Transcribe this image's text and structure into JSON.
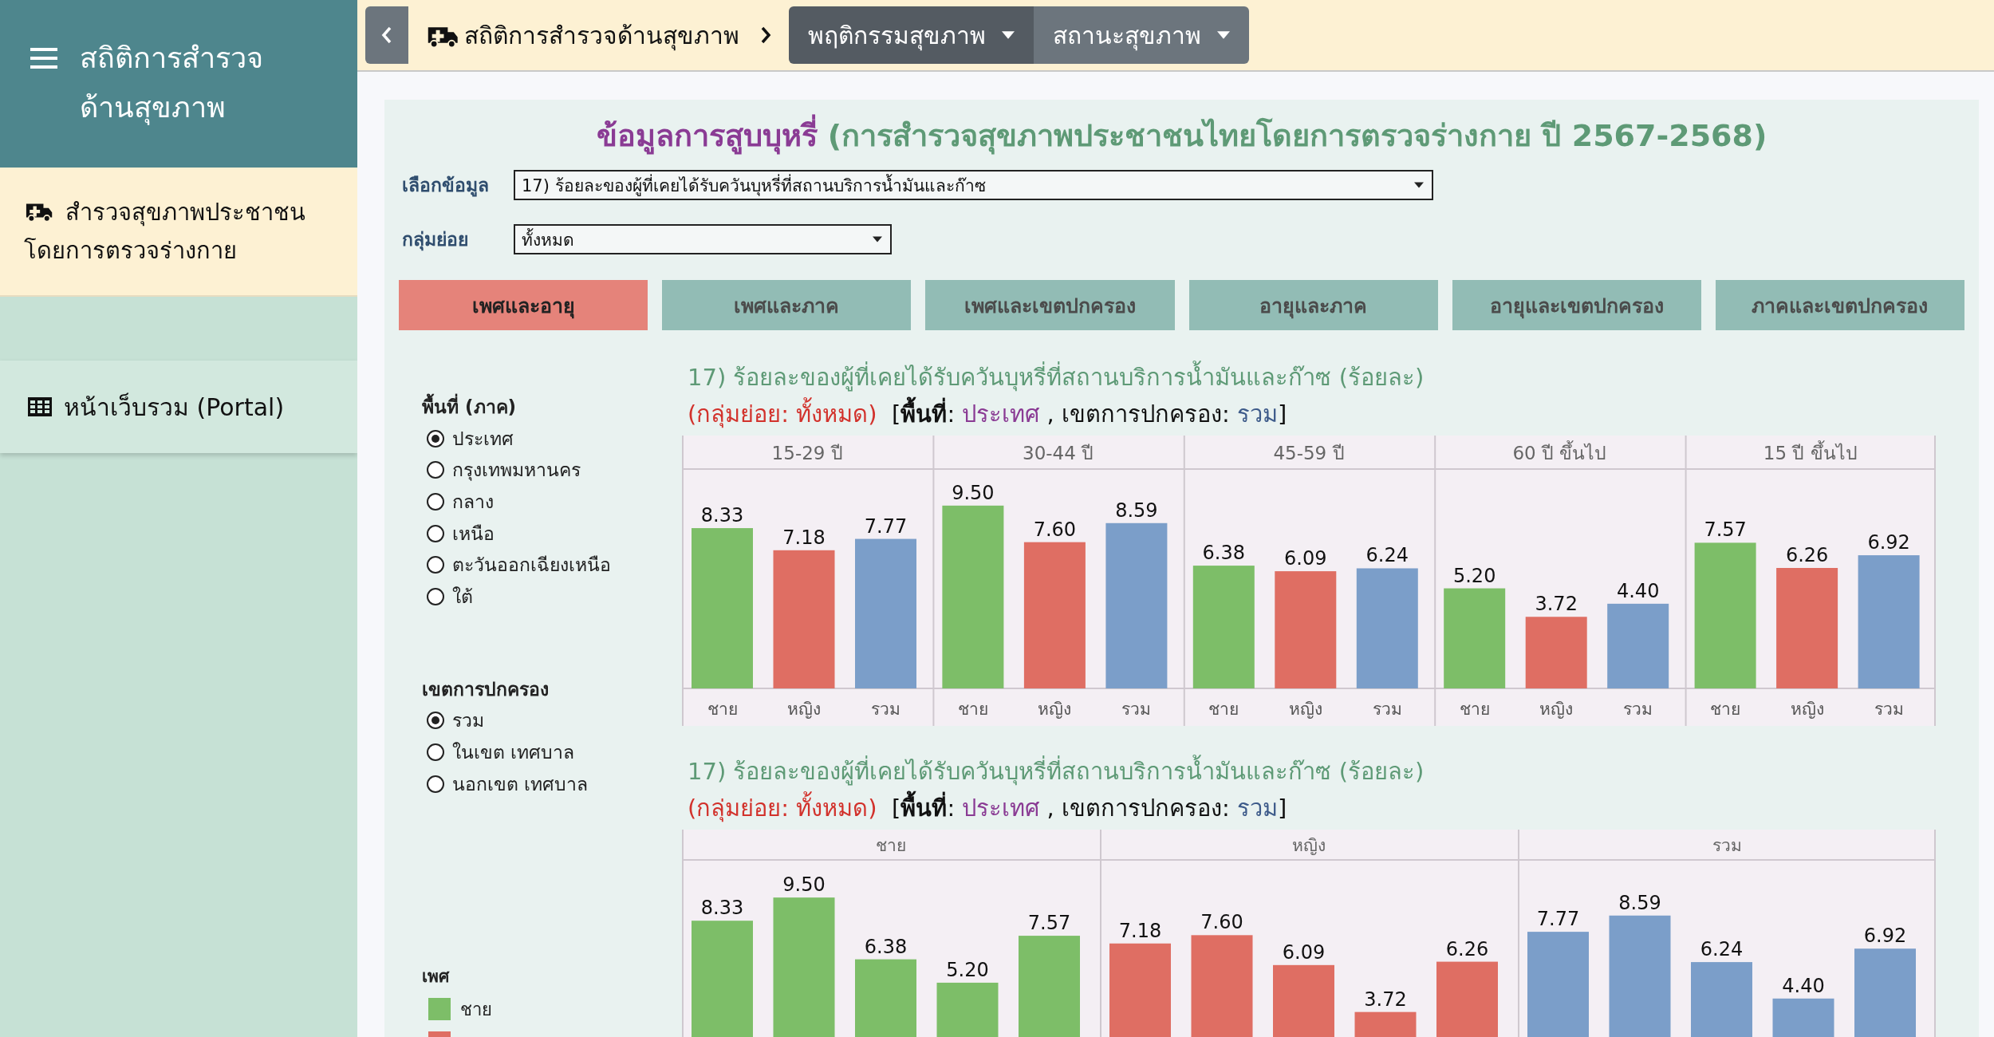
{
  "sidebar": {
    "title_lines": [
      "สถิติการสำรวจ",
      "ด้านสุขภาพ"
    ],
    "items": [
      {
        "label": "สำรวจสุขภาพประชาชน โดยการตรวจร่างกาย",
        "kind": "survey"
      },
      {
        "label": "หน้าเว็บรวม (Portal)",
        "kind": "portal"
      }
    ]
  },
  "topbar": {
    "breadcrumb": "สถิติการสำรวจด้านสุขภาพ",
    "menus": [
      {
        "label": "พฤติกรรมสุขภาพ",
        "selected": true
      },
      {
        "label": "สถานะสุขภาพ",
        "selected": false
      }
    ]
  },
  "page": {
    "title": [
      {
        "kind": "topic",
        "text": "ข้อมูลการสูบบุหรี่"
      },
      {
        "kind": "survey",
        "text": " (การสำรวจสุขภาพประชาชนไทยโดยการตรวจร่างกาย ปี 2567-2568)"
      }
    ],
    "fields": [
      {
        "label": "เลือกข้อมูล",
        "value": "17) ร้อยละของผู้ที่เคยได้รับควันบุหรี่ที่สถานบริการน้ำมันและก๊าซ",
        "kind": "wide"
      },
      {
        "label": "กลุ่มย่อย",
        "value": "ทั้งหมด",
        "kind": "narrow"
      }
    ]
  },
  "tabs": [
    {
      "label": "เพศและอายุ",
      "selected": true
    },
    {
      "label": "เพศและภาค",
      "selected": false
    },
    {
      "label": "เพศและเขตปกครอง",
      "selected": false
    },
    {
      "label": "อายุและภาค",
      "selected": false
    },
    {
      "label": "อายุและเขตปกครอง",
      "selected": false
    },
    {
      "label": "ภาคและเขตปกครอง",
      "selected": false
    }
  ],
  "filters": [
    {
      "title": "พื้นที่ (ภาค)",
      "options": [
        {
          "label": "ประเทศ",
          "selected": true
        },
        {
          "label": "กรุงเทพมหานคร",
          "selected": false
        },
        {
          "label": "กลาง",
          "selected": false
        },
        {
          "label": "เหนือ",
          "selected": false
        },
        {
          "label": "ตะวันออกเฉียงเหนือ",
          "selected": false
        },
        {
          "label": "ใต้",
          "selected": false
        }
      ]
    },
    {
      "title": "เขตการปกครอง",
      "options": [
        {
          "label": "รวม",
          "selected": true
        },
        {
          "label": "ในเขต เทศบาล",
          "selected": false
        },
        {
          "label": "นอกเขต เทศบาล",
          "selected": false
        }
      ]
    }
  ],
  "legend": {
    "title": "เพศ",
    "items": [
      {
        "label": "ชาย",
        "color": "#7dbe68"
      },
      {
        "color": "#df6e63"
      }
    ]
  },
  "charts": [
    {
      "title": "17) ร้อยละของผู้ที่เคยได้รับควันบุหรี่ที่สถานบริการน้ำมันและก๊าซ (ร้อยละ)",
      "subtitle": [
        {
          "kind": "group",
          "text": "(กลุ่มย่อย: ทั้งหมด)"
        },
        {
          "kind": "plain",
          "text": "  ["
        },
        {
          "kind": "label",
          "text": "พื้นที่"
        },
        {
          "kind": "plain",
          "text": ": "
        },
        {
          "kind": "area",
          "text": "ประเทศ"
        },
        {
          "kind": "plain",
          "text": " , เขตการปกครอง: "
        },
        {
          "kind": "admin",
          "text": "รวม"
        },
        {
          "kind": "plain",
          "text": "]"
        }
      ],
      "chart_data": {
        "type": "bar",
        "categories": [
          "15-29 ปี",
          "30-44 ปี",
          "45-59 ปี",
          "60 ปี ขึ้นไป",
          "15 ปี ขึ้นไป"
        ],
        "ylim": [
          0,
          11.4
        ],
        "data_labels": true,
        "series": [
          {
            "name": "ชาย",
            "color": "#7dbe68",
            "values": [
              8.33,
              9.5,
              6.38,
              5.2,
              7.57
            ],
            "value_labels": [
              "8.33",
              "9.50",
              "6.38",
              "5.20",
              "7.57"
            ]
          },
          {
            "name": "หญิง",
            "color": "#df6e63",
            "values": [
              7.18,
              7.6,
              6.09,
              3.72,
              6.26
            ],
            "value_labels": [
              "7.18",
              "7.60",
              "6.09",
              "3.72",
              "6.26"
            ]
          },
          {
            "name": "รวม",
            "color": "#7b9ec9",
            "values": [
              7.77,
              8.59,
              6.24,
              4.4,
              6.92
            ],
            "value_labels": [
              "7.77",
              "8.59",
              "6.24",
              "4.40",
              "6.92"
            ]
          }
        ]
      }
    },
    {
      "title": "17) ร้อยละของผู้ที่เคยได้รับควันบุหรี่ที่สถานบริการน้ำมันและก๊าซ (ร้อยละ)",
      "subtitle": [
        {
          "kind": "group",
          "text": "(กลุ่มย่อย: ทั้งหมด)"
        },
        {
          "kind": "plain",
          "text": "  ["
        },
        {
          "kind": "label",
          "text": "พื้นที่"
        },
        {
          "kind": "plain",
          "text": ": "
        },
        {
          "kind": "area",
          "text": "ประเทศ"
        },
        {
          "kind": "plain",
          "text": " , เขตการปกครอง: "
        },
        {
          "kind": "admin",
          "text": "รวม"
        },
        {
          "kind": "plain",
          "text": "]"
        }
      ],
      "chart_data": {
        "type": "bar",
        "categories": [
          "ชาย",
          "หญิง",
          "รวม"
        ],
        "ylim": [
          0,
          11.4
        ],
        "data_labels": true,
        "series": [
          {
            "colors": [
              "#7dbe68",
              "#df6e63",
              "#7b9ec9"
            ],
            "values": [
              8.33,
              7.18,
              7.77
            ],
            "value_labels": [
              "8.33",
              "7.18",
              "7.77"
            ]
          },
          {
            "colors": [
              "#7dbe68",
              "#df6e63",
              "#7b9ec9"
            ],
            "values": [
              9.5,
              7.6,
              8.59
            ],
            "value_labels": [
              "9.50",
              "7.60",
              "8.59"
            ]
          },
          {
            "colors": [
              "#7dbe68",
              "#df6e63",
              "#7b9ec9"
            ],
            "values": [
              6.38,
              6.09,
              6.24
            ],
            "value_labels": [
              "6.38",
              "6.09",
              "6.24"
            ]
          },
          {
            "colors": [
              "#7dbe68",
              "#df6e63",
              "#7b9ec9"
            ],
            "values": [
              5.2,
              3.72,
              4.4
            ],
            "value_labels": [
              "5.20",
              "3.72",
              "4.40"
            ]
          },
          {
            "colors": [
              "#7dbe68",
              "#df6e63",
              "#7b9ec9"
            ],
            "values": [
              7.57,
              6.26,
              6.92
            ],
            "value_labels": [
              "7.57",
              "6.26",
              "6.92"
            ]
          }
        ]
      }
    }
  ]
}
